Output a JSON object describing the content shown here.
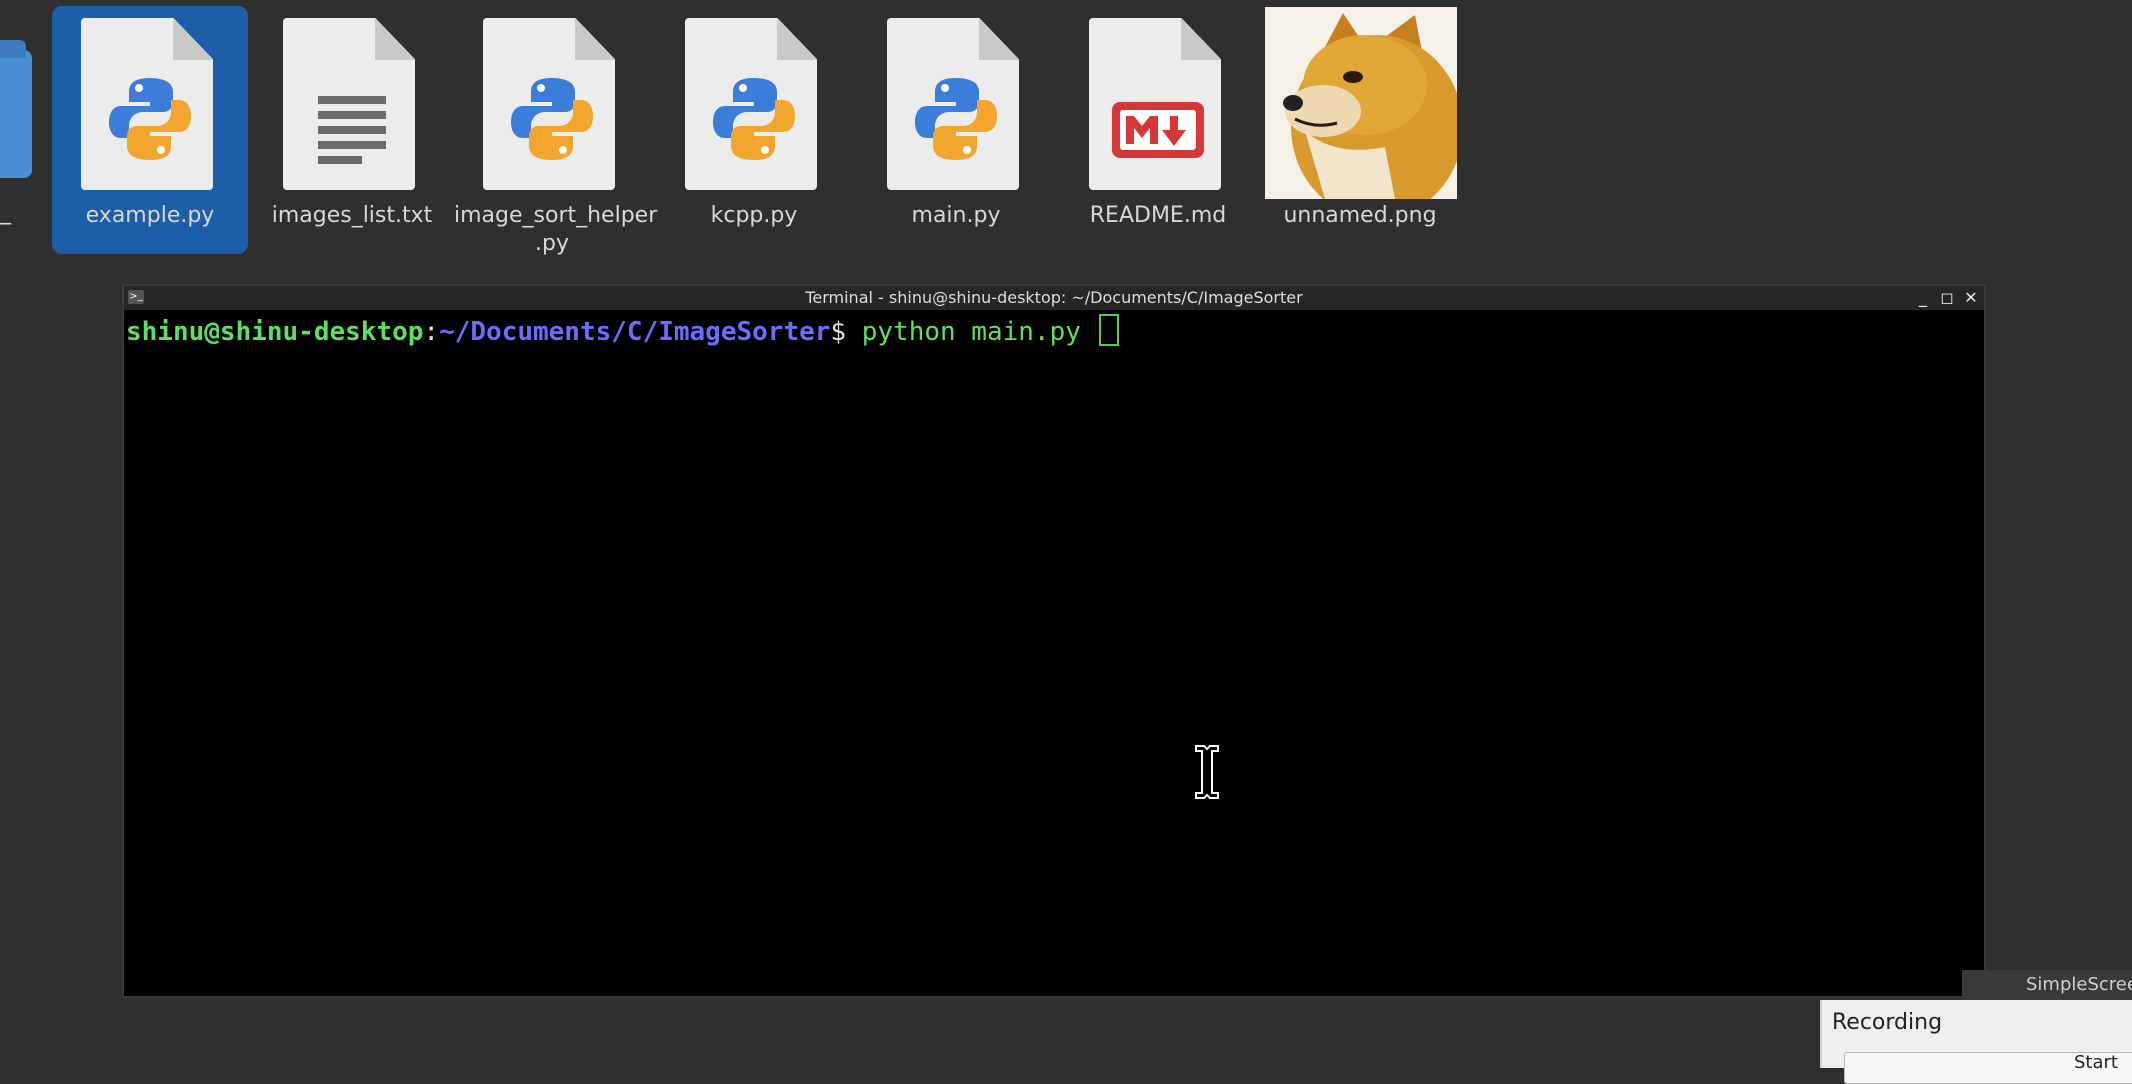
{
  "desktop": {
    "partial_folder_label": "_",
    "items": [
      {
        "name": "example.py",
        "icon": "python-icon",
        "selected": true
      },
      {
        "name": "images_list.txt",
        "icon": "text-file-icon",
        "selected": false
      },
      {
        "name": "image_sort_helper\n.py",
        "icon": "python-icon",
        "selected": false
      },
      {
        "name": "kcpp.py",
        "icon": "python-icon",
        "selected": false
      },
      {
        "name": "main.py",
        "icon": "python-icon",
        "selected": false
      },
      {
        "name": "README.md",
        "icon": "markdown-icon",
        "selected": false
      },
      {
        "name": "unnamed.png",
        "icon": "image-thumbnail",
        "selected": false
      }
    ]
  },
  "terminal": {
    "title": "Terminal - shinu@shinu-desktop: ~/Documents/C/ImageSorter",
    "prompt_user": "shinu@shinu-desktop",
    "prompt_colon": ":",
    "prompt_path": "~/Documents/C/ImageSorter",
    "prompt_dollar": "$ ",
    "command": "python main.py ",
    "controls": [
      "minimize-icon",
      "maximize-icon",
      "close-icon"
    ]
  },
  "recorder": {
    "title": "SimpleScreen",
    "heading": "Recording",
    "start_label": "Start"
  },
  "colors": {
    "desktop_bg": "#2f2f2f",
    "selection": "#1c5fa8",
    "prompt_green": "#5ee05e",
    "prompt_blue": "#6c6cff"
  }
}
